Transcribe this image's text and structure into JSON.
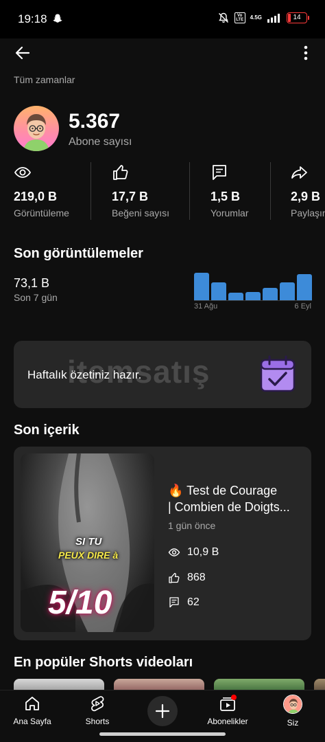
{
  "status_bar": {
    "time": "19:18",
    "network": "4.5G",
    "volte": "Vo LTE",
    "battery": "14"
  },
  "header": {
    "time_range": "Tüm zamanlar"
  },
  "channel": {
    "subscriber_count": "5.367",
    "subscriber_label": "Abone sayısı"
  },
  "stats": [
    {
      "icon": "eye-icon",
      "value": "219,0 B",
      "label": "Görüntüleme"
    },
    {
      "icon": "thumbs-up-icon",
      "value": "17,7 B",
      "label": "Beğeni sayısı"
    },
    {
      "icon": "comment-icon",
      "value": "1,5 B",
      "label": "Yorumlar"
    },
    {
      "icon": "share-icon",
      "value": "2,9 B",
      "label": "Paylaşım"
    }
  ],
  "recent_views": {
    "title": "Son görüntülemeler",
    "value": "73,1 B",
    "label": "Son 7 gün",
    "chart_data": {
      "type": "bar",
      "x_start_label": "31 Ağu",
      "x_end_label": "6 Eyl",
      "values": [
        1.0,
        0.66,
        0.27,
        0.3,
        0.46,
        0.66,
        0.95
      ],
      "color": "#3d8bd9"
    }
  },
  "weekly_summary": {
    "text": "Haftalık özetiniz hazır.",
    "watermark": "itemsatış"
  },
  "latest_content": {
    "title": "Son içerik",
    "video_title_line1": "🔥 Test de Courage",
    "video_title_line2": "| Combien de Doigts...",
    "published": "1 gün önce",
    "views": "10,9 B",
    "likes": "868",
    "comments": "62",
    "thumbnail_text": {
      "line1": "SI TU",
      "line2": "PEUX DIRE à",
      "score": "5/10"
    }
  },
  "popular_shorts": {
    "title": "En popüler Shorts videoları"
  },
  "bottom_nav": {
    "home": "Ana Sayfa",
    "shorts": "Shorts",
    "subscriptions": "Abonelikler",
    "you": "Siz"
  },
  "colors": {
    "accent_bar": "#3d8bd9",
    "notification_dot": "#ff0000",
    "card_bg": "#272727"
  }
}
